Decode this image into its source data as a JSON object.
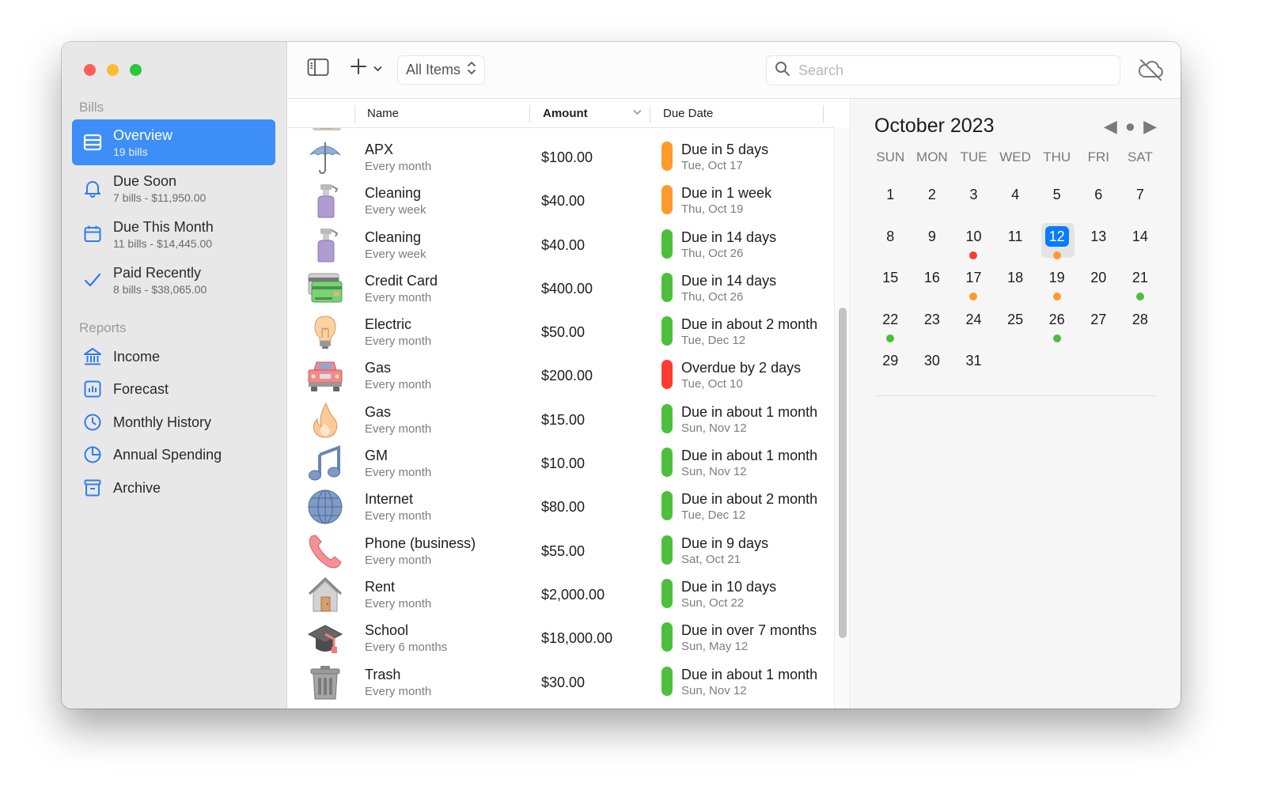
{
  "window": {
    "title": "Bills"
  },
  "colors": {
    "accent": "#3d8ef7",
    "today": "#0a7aff",
    "orange": "#fe9a2e",
    "green": "#4cbf3c",
    "red": "#fe3b30",
    "icon_blue": "#2f7bf5"
  },
  "sidebar": {
    "bills_label": "Bills",
    "reports_label": "Reports",
    "bills_items": [
      {
        "label": "Overview",
        "sub": "19 bills",
        "icon": "list-icon",
        "active": true
      },
      {
        "label": "Due Soon",
        "sub": "7 bills - $11,950.00",
        "icon": "bell-icon"
      },
      {
        "label": "Due This Month",
        "sub": "11 bills - $14,445.00",
        "icon": "calendar-icon"
      },
      {
        "label": "Paid Recently",
        "sub": "8 bills - $38,065.00",
        "icon": "checkmark-icon"
      }
    ],
    "report_items": [
      {
        "label": "Income",
        "icon": "bank-icon"
      },
      {
        "label": "Forecast",
        "icon": "chart-icon"
      },
      {
        "label": "Monthly History",
        "icon": "clock-icon"
      },
      {
        "label": "Annual Spending",
        "icon": "pie-icon"
      },
      {
        "label": "Archive",
        "icon": "archive-icon"
      }
    ]
  },
  "toolbar": {
    "filter_label": "All Items",
    "search_placeholder": "Search",
    "search_value": ""
  },
  "list": {
    "columns": {
      "name": "Name",
      "amount": "Amount",
      "due": "Due Date"
    },
    "rows": [
      {
        "icon": "umbrella-icon",
        "name": "APX",
        "freq": "Every month",
        "amount": "$100.00",
        "status": "Due in 5 days",
        "date": "Tue, Oct 17",
        "state": "orange"
      },
      {
        "icon": "spray-bottle-icon",
        "name": "Cleaning",
        "freq": "Every week",
        "amount": "$40.00",
        "status": "Due in 1 week",
        "date": "Thu, Oct 19",
        "state": "orange"
      },
      {
        "icon": "spray-bottle-icon",
        "name": "Cleaning",
        "freq": "Every week",
        "amount": "$40.00",
        "status": "Due in 14 days",
        "date": "Thu, Oct 26",
        "state": "green"
      },
      {
        "icon": "credit-card-icon",
        "name": "Credit Card",
        "freq": "Every month",
        "amount": "$400.00",
        "status": "Due in 14 days",
        "date": "Thu, Oct 26",
        "state": "green"
      },
      {
        "icon": "lightbulb-icon",
        "name": "Electric",
        "freq": "Every month",
        "amount": "$50.00",
        "status": "Due in about 2 months",
        "date": "Tue, Dec 12",
        "state": "green"
      },
      {
        "icon": "car-icon",
        "name": "Gas",
        "freq": "Every month",
        "amount": "$200.00",
        "status": "Overdue by 2 days",
        "date": "Tue, Oct 10",
        "state": "red"
      },
      {
        "icon": "flame-icon",
        "name": "Gas",
        "freq": "Every month",
        "amount": "$15.00",
        "status": "Due in about 1 month",
        "date": "Sun, Nov 12",
        "state": "green"
      },
      {
        "icon": "music-note-icon",
        "name": "GM",
        "freq": "Every month",
        "amount": "$10.00",
        "status": "Due in about 1 month",
        "date": "Sun, Nov 12",
        "state": "green"
      },
      {
        "icon": "globe-icon",
        "name": "Internet",
        "freq": "Every month",
        "amount": "$80.00",
        "status": "Due in about 2 months",
        "date": "Tue, Dec 12",
        "state": "green"
      },
      {
        "icon": "phone-icon",
        "name": "Phone (business)",
        "freq": "Every month",
        "amount": "$55.00",
        "status": "Due in 9 days",
        "date": "Sat, Oct 21",
        "state": "green"
      },
      {
        "icon": "house-icon",
        "name": "Rent",
        "freq": "Every month",
        "amount": "$2,000.00",
        "status": "Due in 10 days",
        "date": "Sun, Oct 22",
        "state": "green"
      },
      {
        "icon": "graduation-cap-icon",
        "name": "School",
        "freq": "Every 6 months",
        "amount": "$18,000.00",
        "status": "Due in over 7 months",
        "date": "Sun, May 12",
        "state": "green"
      },
      {
        "icon": "trash-can-icon",
        "name": "Trash",
        "freq": "Every month",
        "amount": "$30.00",
        "status": "Due in about 1 month",
        "date": "Sun, Nov 12",
        "state": "green"
      }
    ]
  },
  "calendar": {
    "title": "October 2023",
    "nav": {
      "prev": "◀",
      "today": "●",
      "next": "▶"
    },
    "weekdays": [
      "SUN",
      "MON",
      "TUE",
      "WED",
      "THU",
      "FRI",
      "SAT"
    ],
    "first_weekday_index": 0,
    "days_in_month": 31,
    "today": 12,
    "markers": {
      "10": "red",
      "12": "orange",
      "17": "orange",
      "19": "orange",
      "21": "green",
      "22": "green",
      "26": "green"
    }
  }
}
